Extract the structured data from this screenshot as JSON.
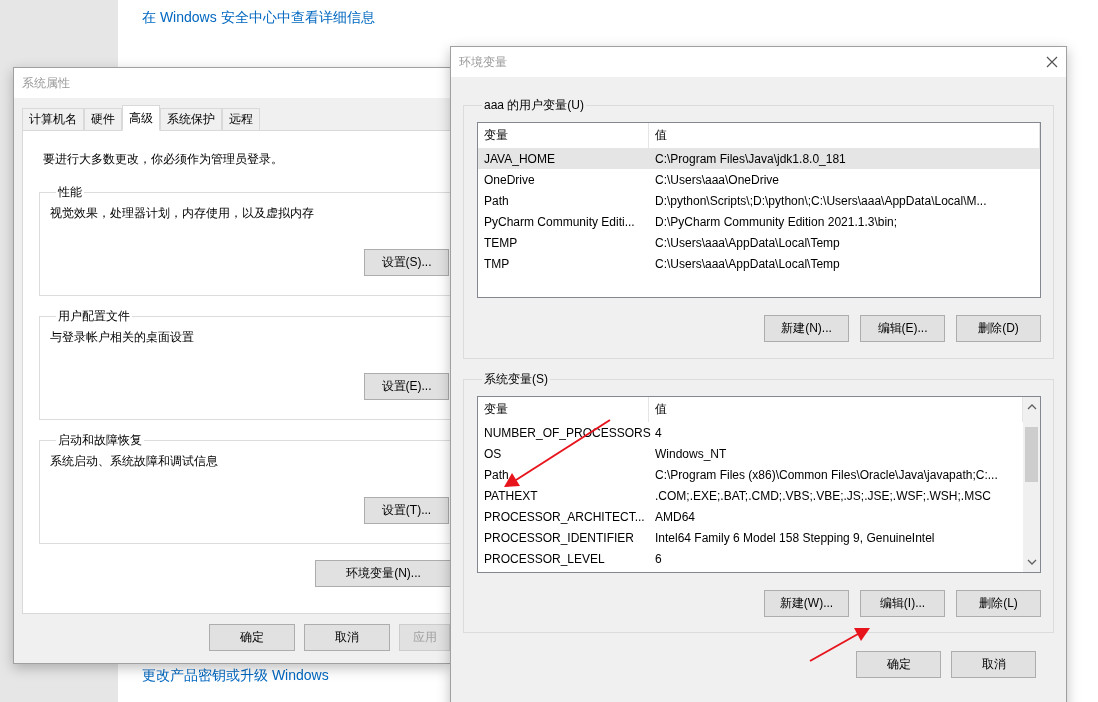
{
  "background": {
    "links": [
      {
        "text": "在 Windows 安全中心中查看详细信息"
      },
      {
        "text": "更改产品密钥或升级 Windows"
      }
    ]
  },
  "system_properties": {
    "title": "系统属性",
    "tabs": [
      {
        "label": "计算机名",
        "selected": false
      },
      {
        "label": "硬件",
        "selected": false
      },
      {
        "label": "高级",
        "selected": true
      },
      {
        "label": "系统保护",
        "selected": false
      },
      {
        "label": "远程",
        "selected": false
      }
    ],
    "notice": "要进行大多数更改，你必须作为管理员登录。",
    "groups": [
      {
        "legend": "性能",
        "description": "视觉效果，处理器计划，内存使用，以及虚拟内存",
        "button": "设置(S)..."
      },
      {
        "legend": "用户配置文件",
        "description": "与登录帐户相关的桌面设置",
        "button": "设置(E)..."
      },
      {
        "legend": "启动和故障恢复",
        "description": "系统启动、系统故障和调试信息",
        "button": "设置(T)..."
      }
    ],
    "env_button": "环境变量(N)...",
    "buttons": [
      {
        "label": "确定",
        "disabled": false
      },
      {
        "label": "取消",
        "disabled": false
      },
      {
        "label": "应用",
        "disabled": true
      }
    ]
  },
  "environment_variables": {
    "title": "环境变量",
    "user_variables": {
      "legend": "aaa 的用户变量(U)",
      "columns": [
        "变量",
        "值"
      ],
      "rows": [
        {
          "name": "JAVA_HOME",
          "value": "C:\\Program Files\\Java\\jdk1.8.0_181",
          "selected": true
        },
        {
          "name": "OneDrive",
          "value": "C:\\Users\\aaa\\OneDrive",
          "selected": false
        },
        {
          "name": "Path",
          "value": "D:\\python\\Scripts\\;D:\\python\\;C:\\Users\\aaa\\AppData\\Local\\M...",
          "selected": false
        },
        {
          "name": "PyCharm Community Editi...",
          "value": "D:\\PyCharm Community Edition 2021.1.3\\bin;",
          "selected": false
        },
        {
          "name": "TEMP",
          "value": "C:\\Users\\aaa\\AppData\\Local\\Temp",
          "selected": false
        },
        {
          "name": "TMP",
          "value": "C:\\Users\\aaa\\AppData\\Local\\Temp",
          "selected": false
        }
      ],
      "buttons": [
        "新建(N)...",
        "编辑(E)...",
        "删除(D)"
      ]
    },
    "system_variables": {
      "legend": "系统变量(S)",
      "columns": [
        "变量",
        "值"
      ],
      "rows": [
        {
          "name": "NUMBER_OF_PROCESSORS",
          "value": "4",
          "selected": false
        },
        {
          "name": "OS",
          "value": "Windows_NT",
          "selected": false
        },
        {
          "name": "Path",
          "value": "C:\\Program Files (x86)\\Common Files\\Oracle\\Java\\javapath;C:...",
          "selected": false
        },
        {
          "name": "PATHEXT",
          "value": ".COM;.EXE;.BAT;.CMD;.VBS;.VBE;.JS;.JSE;.WSF;.WSH;.MSC",
          "selected": false
        },
        {
          "name": "PROCESSOR_ARCHITECT...",
          "value": "AMD64",
          "selected": false
        },
        {
          "name": "PROCESSOR_IDENTIFIER",
          "value": "Intel64 Family 6 Model 158 Stepping 9, GenuineIntel",
          "selected": false
        },
        {
          "name": "PROCESSOR_LEVEL",
          "value": "6",
          "selected": false
        }
      ],
      "buttons": [
        "新建(W)...",
        "编辑(I)...",
        "删除(L)"
      ]
    },
    "buttons": [
      "确定",
      "取消"
    ]
  }
}
